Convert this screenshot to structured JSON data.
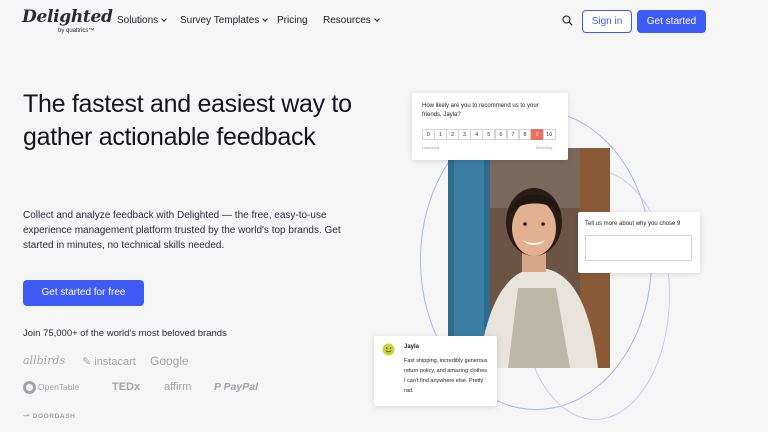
{
  "nav": {
    "logo_text": "Delighted",
    "logo_sub": "by qualtrics™",
    "items": [
      {
        "label": "Solutions",
        "has_dropdown": true
      },
      {
        "label": "Survey Templates",
        "has_dropdown": true
      },
      {
        "label": "Pricing",
        "has_dropdown": false
      },
      {
        "label": "Resources",
        "has_dropdown": true
      }
    ],
    "search_icon": "search-icon",
    "signin_label": "Sign in",
    "get_started_label": "Get started"
  },
  "hero": {
    "headline": "The fastest and easiest way to gather actionable feedback",
    "subtext": "Collect and analyze feedback with Delighted — the free, easy-to-use experience management platform trusted by the world's top brands. Get started in minutes, no technical skills needed.",
    "cta_label": "Get started for free",
    "brands_title": "Join 75,000+ of the world's most beloved brands",
    "brands": [
      "allbirds",
      "instacart",
      "Google",
      "OpenTable",
      "TEDx",
      "affirm",
      "PayPal",
      "DOORDASH"
    ]
  },
  "illustration": {
    "nps_card": {
      "question": "How likely are you to recommend us to your friends, Jayla?",
      "scale": [
        "0",
        "1",
        "2",
        "3",
        "4",
        "5",
        "6",
        "7",
        "8",
        "9",
        "10"
      ],
      "selected": "9",
      "low_label": "Least likely",
      "high_label": "Most likely"
    },
    "followup_card": {
      "question": "Tell us more about why you chose 9"
    },
    "testimonial_card": {
      "name": "Jayla",
      "text": "Fast shipping, incredibly generous return policy, and amazing clothes I can't find anywhere else. Pretty rad."
    }
  },
  "colors": {
    "brand_blue": "#3e5bf5",
    "accent_red": "#f36b5a",
    "background": "#f6f6f6",
    "smile_green": "#c8d63a"
  }
}
